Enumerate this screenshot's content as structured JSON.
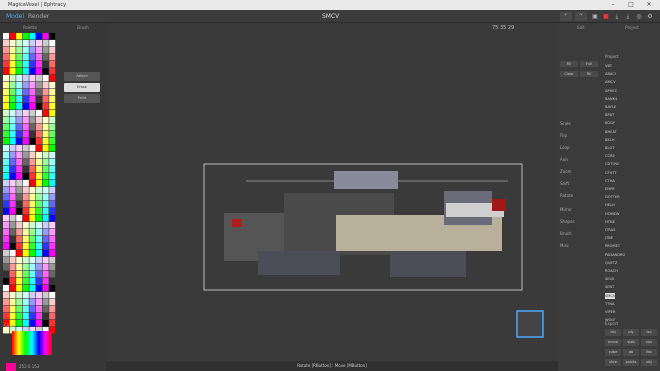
{
  "window": {
    "title": "MagicaVoxel | Ephtracy"
  },
  "menu": {
    "model": "Model",
    "render": "Render"
  },
  "palette": {
    "header": "Palette",
    "brush_header": "Brush",
    "color_label": "Color",
    "r": "R",
    "g": "G",
    "b": "B",
    "hex": "252 0 153"
  },
  "brush": {
    "attach": "Attach",
    "erase": "Erase",
    "paint": "Paint"
  },
  "viewport": {
    "title": "SMCV",
    "dims": "75  35  29",
    "status": "Rotate [RButton] : Move [MButton]"
  },
  "right": {
    "edit_tab": "Edit",
    "project_tab": "Project",
    "tools": {
      "fill": "Fill",
      "full": "Full",
      "clear": "Clear",
      "fill2": "Fill"
    },
    "sections": [
      "Tool",
      "Scale",
      "Flip",
      "Loop",
      "Axis",
      "Zoom",
      "Shift",
      "Rotate",
      "Mirror",
      "Shapes",
      "Brush",
      "Misc"
    ],
    "project_header": "Project",
    "models": [
      "VBT",
      "ABACI",
      "AMCV",
      "APHEC",
      "BANK4",
      "BAYLE",
      "BFBT",
      "BGGY",
      "BHEAT",
      "BKLH",
      "BLGT",
      "CCRE",
      "CDTOW",
      "CFHTT",
      "CTHA",
      "ENPR",
      "GOTTER",
      "HELH",
      "HOMEW",
      "HTNE",
      "ITRAS",
      "JTBE",
      "PROMET",
      "PADANDRO",
      "QUETZ",
      "ROACH",
      "SELB",
      "SENT",
      "SMCV",
      "TTNA",
      "VIPER",
      "WOLF"
    ],
    "export_header": "Export",
    "export_buttons": [
      "obj",
      "ply",
      "iso",
      "mono",
      "slab",
      "vox",
      "cube",
      "qb",
      "fbx",
      "slice",
      "points",
      "obj"
    ]
  }
}
